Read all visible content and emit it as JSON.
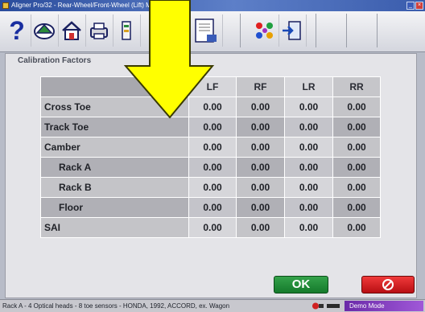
{
  "window": {
    "title": "Aligner Pro/32 - Rear-Wheel/Front-Wheel (Lift) Mode",
    "controls": [
      "minimize",
      "close"
    ]
  },
  "toolbar": {
    "buttons": [
      {
        "icon": "help-icon",
        "label": "?"
      },
      {
        "icon": "vehicle-specs-icon"
      },
      {
        "icon": "home-icon"
      },
      {
        "icon": "print-icon"
      },
      {
        "icon": "tools-icon"
      },
      {
        "icon": "report-icon"
      },
      {
        "icon": "calibration-dots-icon"
      },
      {
        "icon": "exit-icon"
      }
    ]
  },
  "panel": {
    "title": "Calibration Factors"
  },
  "table": {
    "columns": [
      "LF",
      "RF",
      "LR",
      "RR"
    ],
    "rows": [
      {
        "label": "Cross Toe",
        "values": [
          "0.00",
          "0.00",
          "0.00",
          "0.00"
        ],
        "indent": false
      },
      {
        "label": "Track Toe",
        "values": [
          "0.00",
          "0.00",
          "0.00",
          "0.00"
        ],
        "indent": false
      },
      {
        "label": "Camber",
        "values": [
          "0.00",
          "0.00",
          "0.00",
          "0.00"
        ],
        "indent": false
      },
      {
        "label": "Rack A",
        "values": [
          "0.00",
          "0.00",
          "0.00",
          "0.00"
        ],
        "indent": true
      },
      {
        "label": "Rack B",
        "values": [
          "0.00",
          "0.00",
          "0.00",
          "0.00"
        ],
        "indent": true
      },
      {
        "label": "Floor",
        "values": [
          "0.00",
          "0.00",
          "0.00",
          "0.00"
        ],
        "indent": true
      },
      {
        "label": "SAI",
        "values": [
          "0.00",
          "0.00",
          "0.00",
          "0.00"
        ],
        "indent": false
      }
    ]
  },
  "buttons": {
    "ok_label": "OK",
    "cancel_icon": "cancel-icon"
  },
  "statusbar": {
    "text": "Rack A - 4 Optical heads - 8 toe sensors - HONDA, 1992, ACCORD, ex. Wagon",
    "mode": "Demo Mode"
  },
  "colors": {
    "arrow": "#ffff00",
    "ok": "#1f8f3a",
    "cancel": "#d81e22",
    "mode_badge": "#8a3cc8"
  }
}
